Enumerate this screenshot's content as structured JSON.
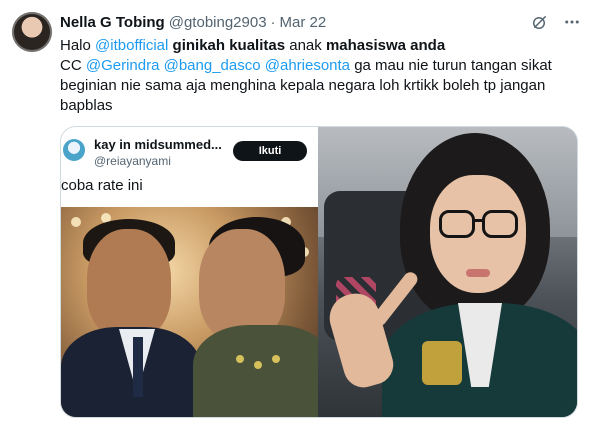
{
  "author": {
    "display_name": "Nella G Tobing",
    "handle": "@gtobing2903",
    "date": "Mar 22"
  },
  "icons": [
    "grok-icon",
    "more-icon"
  ],
  "tweet": {
    "line1": {
      "p1": "Halo ",
      "m1": "@itbofficial",
      "p2": " ",
      "b1": "ginikah kualitas",
      "p3": " anak ",
      "b2": "mahasiswa anda"
    },
    "line2": {
      "p1": "CC ",
      "m1": "@Gerindra",
      "p2": " ",
      "m2": "@bang_dasco",
      "p3": " ",
      "m3": "@ahriesonta",
      "p4": " ga mau nie turun tangan sikat"
    },
    "line3": "beginian nie sama aja menghina kepala negara loh krtikk boleh tp jangan",
    "line4": "bapblas"
  },
  "embedded_screenshot": {
    "name": "kay in midsummed...",
    "handle": "@reiayanyami",
    "follow_label": "Ikuti",
    "text": "coba rate ini"
  },
  "colors": {
    "link": "#1d9bf0",
    "secondary_text": "#536471",
    "border": "#cfd9de"
  }
}
